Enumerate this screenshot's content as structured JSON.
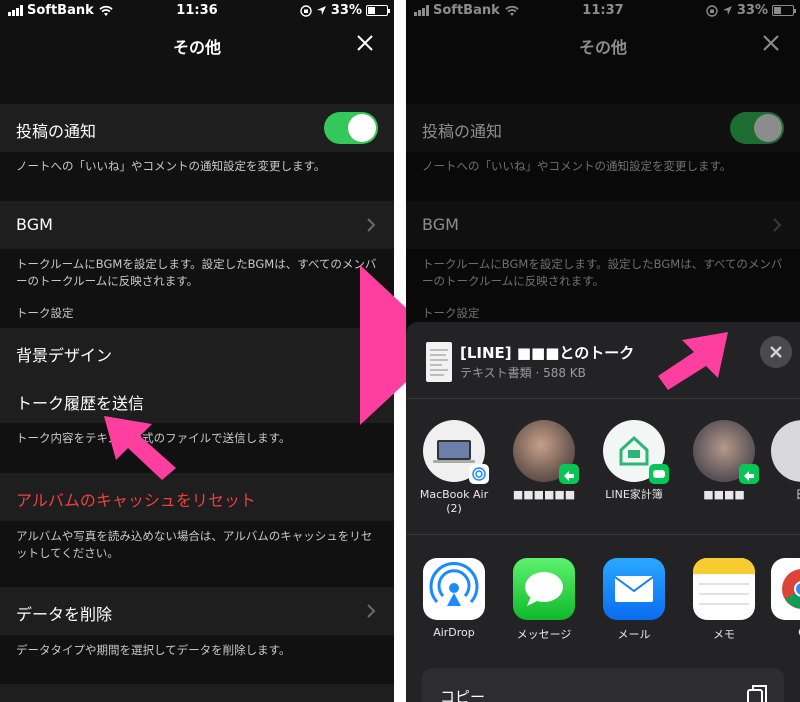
{
  "status_left": {
    "carrier": "SoftBank",
    "time": "11:36",
    "battery": "33%"
  },
  "status_right": {
    "carrier": "SoftBank",
    "time": "11:37",
    "battery": "33%"
  },
  "battery_level": 0.33,
  "nav": {
    "title": "その他"
  },
  "settings": {
    "post_notification": {
      "label": "投稿の通知",
      "note": "ノートへの「いいね」やコメントの通知設定を変更します。",
      "enabled": true
    },
    "bgm": {
      "label": "BGM",
      "note": "トークルームにBGMを設定します。設定したBGMは、すべてのメンバーのトークルームに反映されます。"
    },
    "talk_settings_header": "トーク設定",
    "background_design": {
      "label": "背景デザイン"
    },
    "send_history": {
      "label": "トーク履歴を送信",
      "note": "トーク内容をテキスト形式のファイルで送信します。"
    },
    "reset_album_cache": {
      "label": "アルバムのキャッシュをリセット",
      "note": "アルバムや写真を読み込めない場合は、アルバムのキャッシュをリセットしてください。"
    },
    "delete_data": {
      "label": "データを削除",
      "note": "データタイプや期間を選択してデータを削除します。"
    }
  },
  "share_sheet": {
    "doc_title": "[LINE] ■■■とのトーク",
    "doc_subtitle": "テキスト書類 · 588 KB",
    "people": [
      {
        "label": "MacBook Air (2)"
      },
      {
        "label": "■■■■■■"
      },
      {
        "label": "LINE家計簿"
      },
      {
        "label": "■■■■"
      },
      {
        "label": "田"
      }
    ],
    "apps": [
      {
        "label": "AirDrop",
        "icon": "airdrop-icon"
      },
      {
        "label": "メッセージ",
        "icon": "messages-icon"
      },
      {
        "label": "メール",
        "icon": "mail-icon"
      },
      {
        "label": "メモ",
        "icon": "notes-icon"
      },
      {
        "label": "C",
        "icon": "chrome-icon"
      }
    ],
    "copy_label": "コピー"
  },
  "colors": {
    "accent_pink": "#ff3fa0",
    "toggle_green": "#34c759",
    "danger_red": "#e8423f"
  }
}
